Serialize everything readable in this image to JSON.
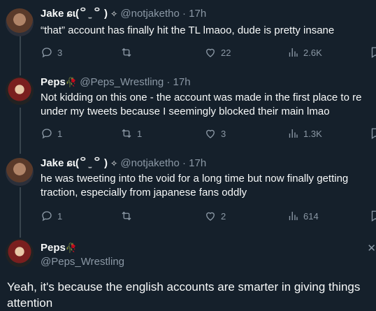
{
  "tweets": [
    {
      "name": "Jake ɕɩ(꒪ ̫ ꒪ )",
      "badge": "✧",
      "handle": "@notjaketho",
      "time": "· 17h",
      "text": [
        "“that” account has finally hit the TL lmaoo, dude is pretty insane"
      ],
      "replies": "3",
      "retweets": "",
      "likes": "22",
      "views": "2.6K"
    },
    {
      "name": "Peps",
      "badge": "🥀",
      "handle": "@Peps_Wrestling",
      "time": "· 17h",
      "text": [
        "Not kidding on this one - the account was made in the first place to re",
        "under my tweets because I seemingly blocked their main lmao"
      ],
      "replies": "1",
      "retweets": "1",
      "likes": "3",
      "views": "1.3K"
    },
    {
      "name": "Jake ɕɩ(꒪ ̫ ꒪ )",
      "badge": "✧",
      "handle": "@notjaketho",
      "time": "· 17h",
      "text": [
        "he was tweeting into the void for a long time but now finally getting",
        "traction, especially from japanese fans oddly"
      ],
      "replies": "1",
      "retweets": "",
      "likes": "2",
      "views": "614"
    }
  ],
  "composer": {
    "name": "Peps",
    "badge": "🥀",
    "handle": "@Peps_Wrestling",
    "text": "Yeah, it's because the english accounts are smarter in giving things attention",
    "close": "✕"
  }
}
